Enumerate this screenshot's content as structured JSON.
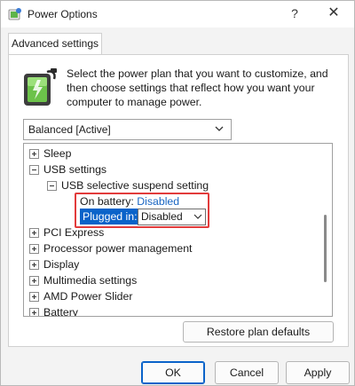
{
  "window": {
    "title": "Power Options",
    "help_symbol": "?",
    "close_symbol": "✕"
  },
  "tabs": [
    {
      "label": "Advanced settings"
    }
  ],
  "description": "Select the power plan that you want to customize, and then choose settings that reflect how you want your computer to manage power.",
  "plan_select": {
    "value": "Balanced [Active]"
  },
  "tree": {
    "items": [
      {
        "label": "Sleep",
        "expanded": false
      },
      {
        "label": "USB settings",
        "expanded": true
      },
      {
        "label": "USB selective suspend setting",
        "expanded": true
      },
      {
        "label": "PCI Express",
        "expanded": false
      },
      {
        "label": "Processor power management",
        "expanded": false
      },
      {
        "label": "Display",
        "expanded": false
      },
      {
        "label": "Multimedia settings",
        "expanded": false
      },
      {
        "label": "AMD Power Slider",
        "expanded": false
      },
      {
        "label": "Battery",
        "expanded": false
      }
    ],
    "on_battery": {
      "label": "On battery:",
      "value": "Disabled"
    },
    "plugged_in": {
      "label": "Plugged in:",
      "value": "Disabled"
    }
  },
  "buttons": {
    "restore": "Restore plan defaults",
    "ok": "OK",
    "cancel": "Cancel",
    "apply": "Apply"
  },
  "colors": {
    "accent": "#0a63c9",
    "link": "#1a66c2",
    "highlight_box": "#e23b3b"
  }
}
